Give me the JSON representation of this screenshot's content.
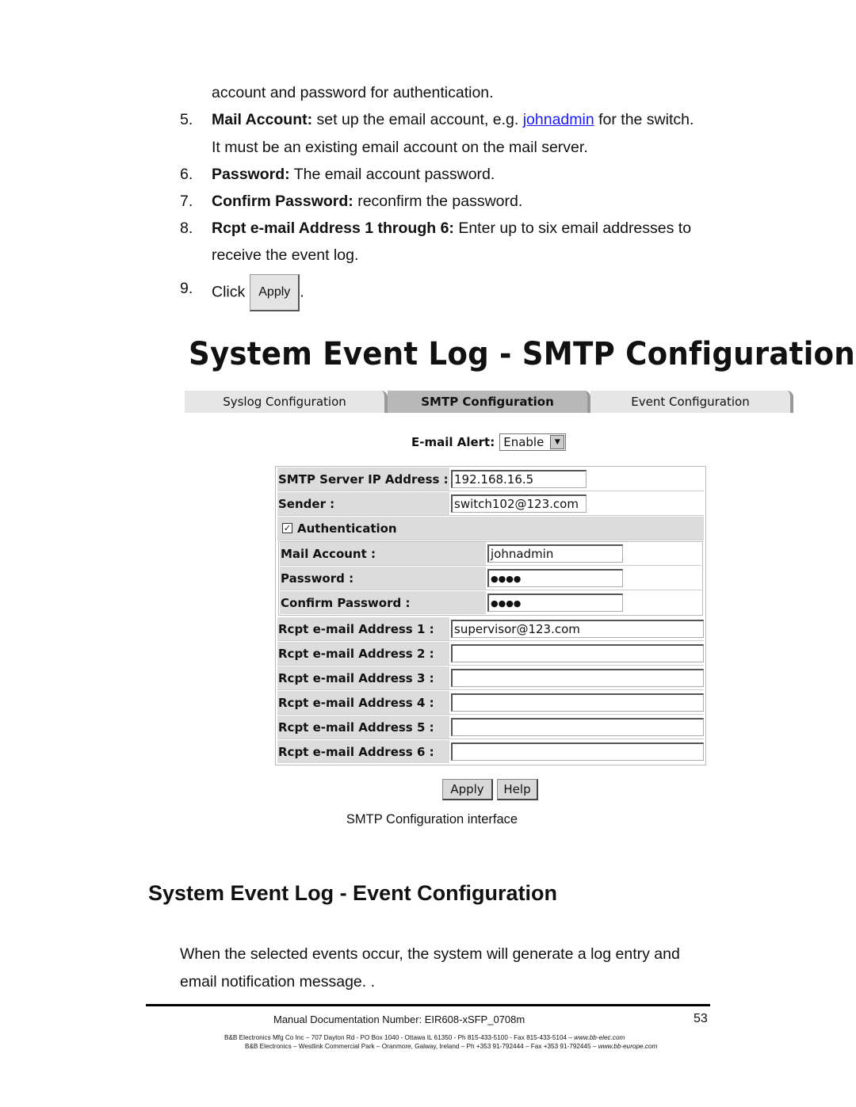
{
  "intro": {
    "line0": "account and password for authentication.",
    "items": [
      {
        "num": "5.",
        "bold": "Mail Account:",
        "pre": " set up the email account, e.g. ",
        "link": "johnadmin",
        "post": " for the switch.",
        "cont": "It must be an existing email account on the mail server."
      },
      {
        "num": "6.",
        "bold": "Password:",
        "text": " The email account password."
      },
      {
        "num": "7.",
        "bold": "Confirm Password:",
        "text": " reconfirm the password."
      },
      {
        "num": "8.",
        "bold": "Rcpt e-mail Address 1 through 6:",
        "text": " Enter up to six email addresses to",
        "cont": "receive the event log."
      },
      {
        "num": "9.",
        "pre": "Click",
        "button": "Apply",
        "post": "."
      }
    ]
  },
  "screenshot": {
    "title": "System Event Log - SMTP Configuration",
    "tabs": [
      "Syslog Configuration",
      "SMTP Configuration",
      "Event Configuration"
    ],
    "active_tab": 1,
    "email_alert": {
      "label": "E-mail Alert:",
      "value": "Enable"
    },
    "smtp_server": {
      "label": "SMTP Server IP Address :",
      "value": "192.168.16.5"
    },
    "sender": {
      "label": "Sender :",
      "value": "switch102@123.com"
    },
    "authentication": {
      "label": "Authentication",
      "checked": true
    },
    "mail_account": {
      "label": "Mail Account :",
      "value": "johnadmin"
    },
    "password": {
      "label": "Password :",
      "value": "●●●●"
    },
    "confirm_password": {
      "label": "Confirm Password :",
      "value": "●●●●"
    },
    "rcpt": [
      {
        "label": "Rcpt e-mail Address 1 :",
        "value": "supervisor@123.com"
      },
      {
        "label": "Rcpt e-mail Address 2 :",
        "value": ""
      },
      {
        "label": "Rcpt e-mail Address 3 :",
        "value": ""
      },
      {
        "label": "Rcpt e-mail Address 4 :",
        "value": ""
      },
      {
        "label": "Rcpt e-mail Address 5 :",
        "value": ""
      },
      {
        "label": "Rcpt e-mail Address 6 :",
        "value": ""
      }
    ],
    "apply": "Apply",
    "help": "Help"
  },
  "caption": "SMTP Configuration interface",
  "section": {
    "heading": "System Event Log - Event Configuration",
    "p1": "When the selected events occur, the system will generate a log entry and",
    "p2": "email notification message. ."
  },
  "footer": {
    "doc": "Manual Documentation Number: EIR608-xSFP_0708m",
    "page": "53",
    "addr1": "B&B Electronics Mfg Co Inc – 707 Dayton Rd - PO Box 1040 - Ottawa IL 61350 - Ph 815-433-5100 - Fax 815-433-5104 – ",
    "web1": "www.bb-elec.com",
    "addr2": "B&B Electronics – Westlink Commercial Park – Oranmore, Galway, Ireland – Ph +353 91-792444 – Fax +353 91-792445 – ",
    "web2": "www.bb-europe.com"
  }
}
